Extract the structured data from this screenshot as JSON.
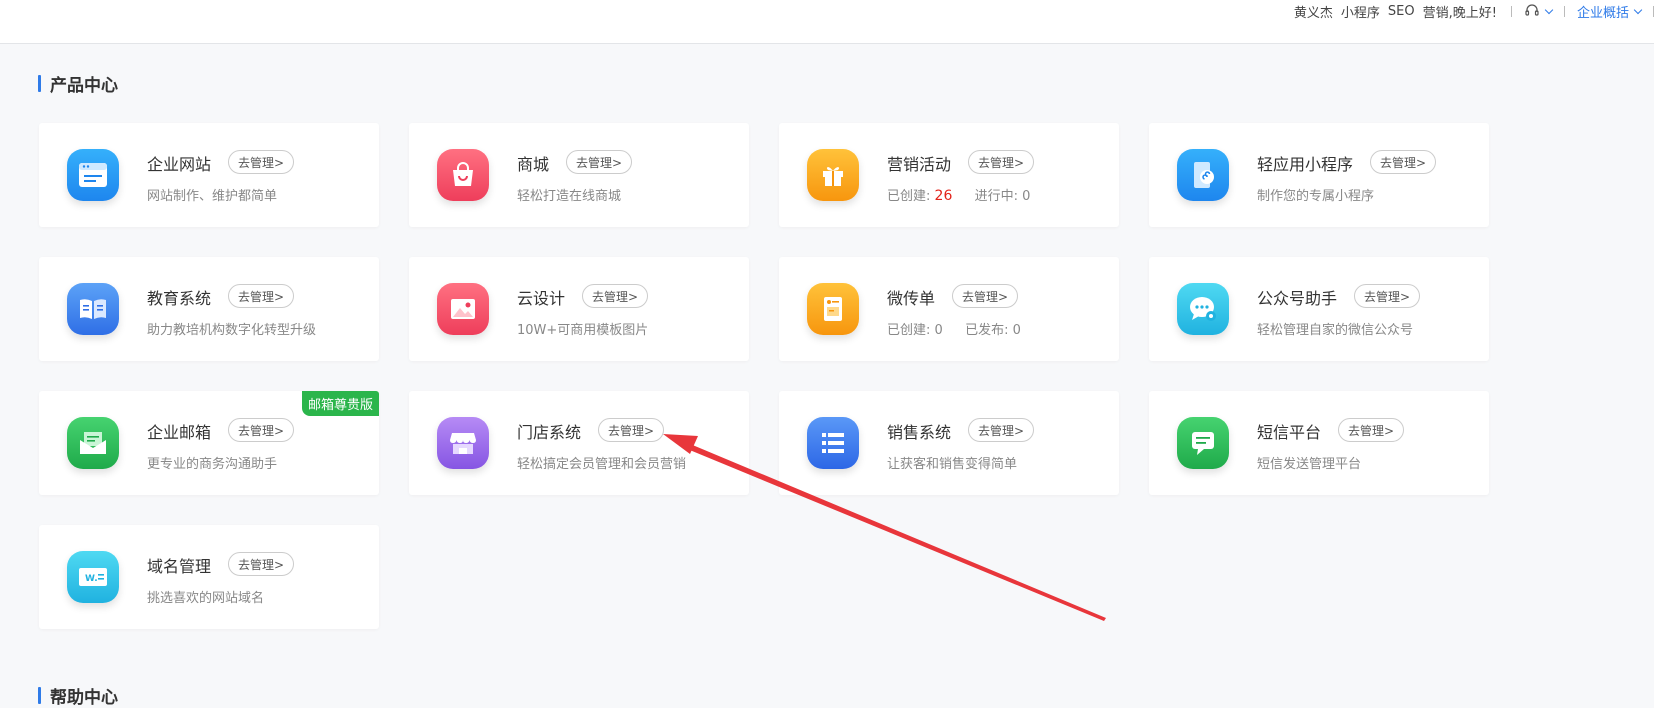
{
  "header": {
    "user_name": "黄义杰",
    "miniapp_label": "小程序",
    "seo_label": "SEO",
    "greeting": "营销,晚上好!",
    "overview_label": "企业概括",
    "support_icon": "headset-icon"
  },
  "products": {
    "title": "产品中心",
    "manage_label": "去管理>",
    "items": [
      {
        "name": "企业网站",
        "desc": "网站制作、维护都简单",
        "icon": "browser-icon",
        "color": "#2b9af3"
      },
      {
        "name": "商城",
        "desc": "轻松打造在线商城",
        "icon": "shopping-bag-icon",
        "color": "#f3566e"
      },
      {
        "name": "营销活动",
        "desc_created_label": "已创建:",
        "desc_created_value": "26",
        "desc_running_label": "进行中:",
        "desc_running_value": "0",
        "icon": "gift-icon",
        "color": "#f9a61a"
      },
      {
        "name": "轻应用小程序",
        "desc": "制作您的专属小程序",
        "icon": "miniprogram-phone-icon",
        "color": "#2b9af3"
      },
      {
        "name": "教育系统",
        "desc": "助力教培机构数字化转型升级",
        "icon": "book-icon",
        "color": "#3f86ef"
      },
      {
        "name": "云设计",
        "desc": "10W+可商用模板图片",
        "icon": "image-icon",
        "color": "#f3566e"
      },
      {
        "name": "微传单",
        "desc_created_label": "已创建:",
        "desc_created_value": "0",
        "desc_published_label": "已发布:",
        "desc_published_value": "0",
        "icon": "flyer-icon",
        "color": "#f9a61a"
      },
      {
        "name": "公众号助手",
        "desc": "轻松管理自家的微信公众号",
        "icon": "wechat-bubble-gear-icon",
        "color": "#2fc6e8"
      },
      {
        "name": "企业邮箱",
        "desc": "更专业的商务沟通助手",
        "icon": "mail-icon",
        "color": "#2bbd5a",
        "badge": "邮箱尊贵版"
      },
      {
        "name": "门店系统",
        "desc": "轻松搞定会员管理和会员营销",
        "icon": "store-icon",
        "color": "#9b6ee8"
      },
      {
        "name": "销售系统",
        "desc": "让获客和销售变得简单",
        "icon": "list-icon",
        "color": "#3f7ef0"
      },
      {
        "name": "短信平台",
        "desc": "短信发送管理平台",
        "icon": "sms-bubble-icon",
        "color": "#2bbd5a"
      },
      {
        "name": "域名管理",
        "desc": "挑选喜欢的网站域名",
        "icon": "domain-icon",
        "color": "#2fc6e8"
      }
    ]
  },
  "help": {
    "title": "帮助中心"
  },
  "colors": {
    "accent": "#2f7be8",
    "highlight_red": "#e2231a",
    "annotation_arrow": "#e8363b"
  }
}
